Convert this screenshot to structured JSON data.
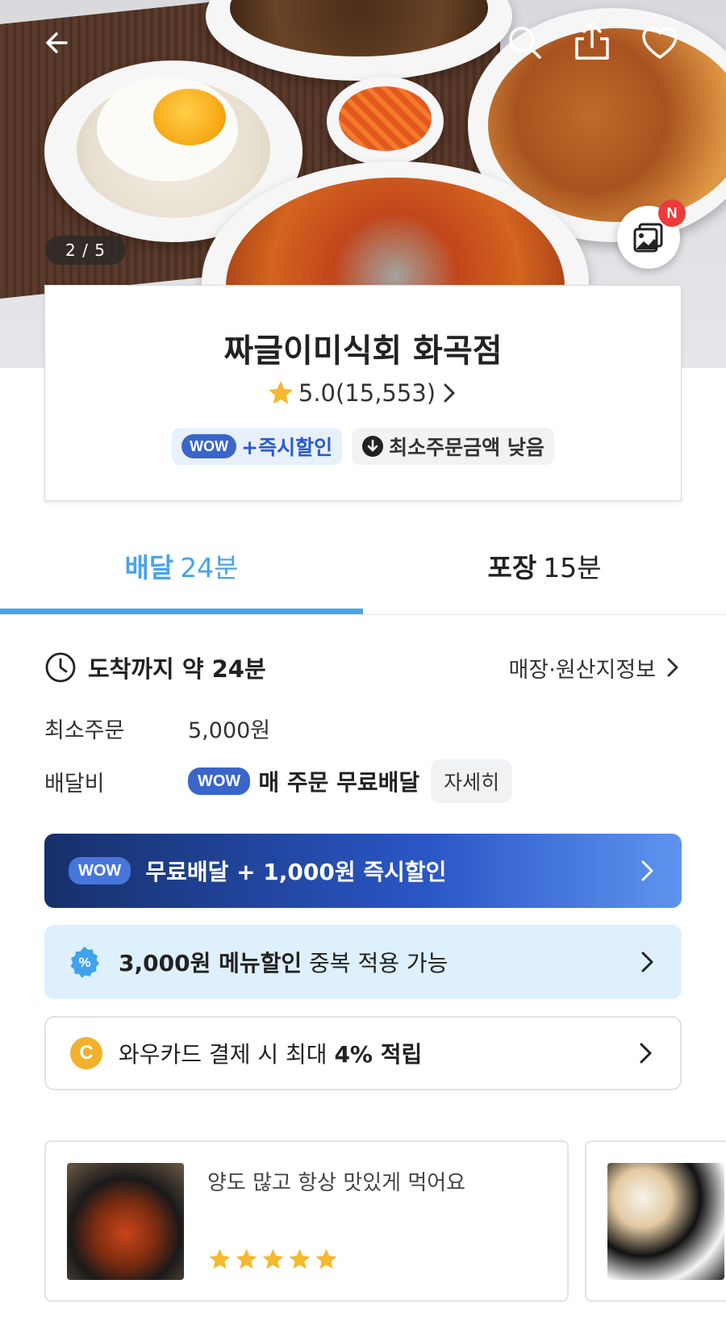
{
  "hero": {
    "image_counter": "2 / 5",
    "new_badge": "N"
  },
  "store": {
    "name": "짜글이미식회 화곡점",
    "rating": "5.0(15,553)",
    "badges": {
      "wow_tag": "WOW",
      "instant_discount": "+즉시할인",
      "min_order_low": "최소주문금액 낮음"
    }
  },
  "tabs": {
    "delivery_label": "배달",
    "delivery_time": "24분",
    "pickup_label": "포장",
    "pickup_time": "15분"
  },
  "info": {
    "arrival": "도착까지 약 24분",
    "store_info_link": "매장·원산지정보",
    "min_order_label": "최소주문",
    "min_order_value": "5,000원",
    "delivery_fee_label": "배달비",
    "delivery_fee_wow": "WOW",
    "delivery_fee_value": "매 주문 무료배달",
    "detail_button": "자세히"
  },
  "banners": {
    "wow": {
      "tag": "WOW",
      "text": "무료배달 + 1,000원 즉시할인"
    },
    "menu_discount": {
      "bold": "3,000원 메뉴할인",
      "rest": " 중복 적용 가능"
    },
    "wow_card": {
      "icon_letter": "C",
      "text": "와우카드 결제 시 최대 ",
      "bold": "4% 적립"
    }
  },
  "reviews": [
    {
      "text": "양도 많고 항상 맛있게 먹어요",
      "stars": 5
    }
  ],
  "colors": {
    "accent_blue": "#4aa3e8",
    "wow_blue": "#3a66c9",
    "star_yellow": "#f5b82e",
    "badge_red": "#ec3b3b"
  }
}
